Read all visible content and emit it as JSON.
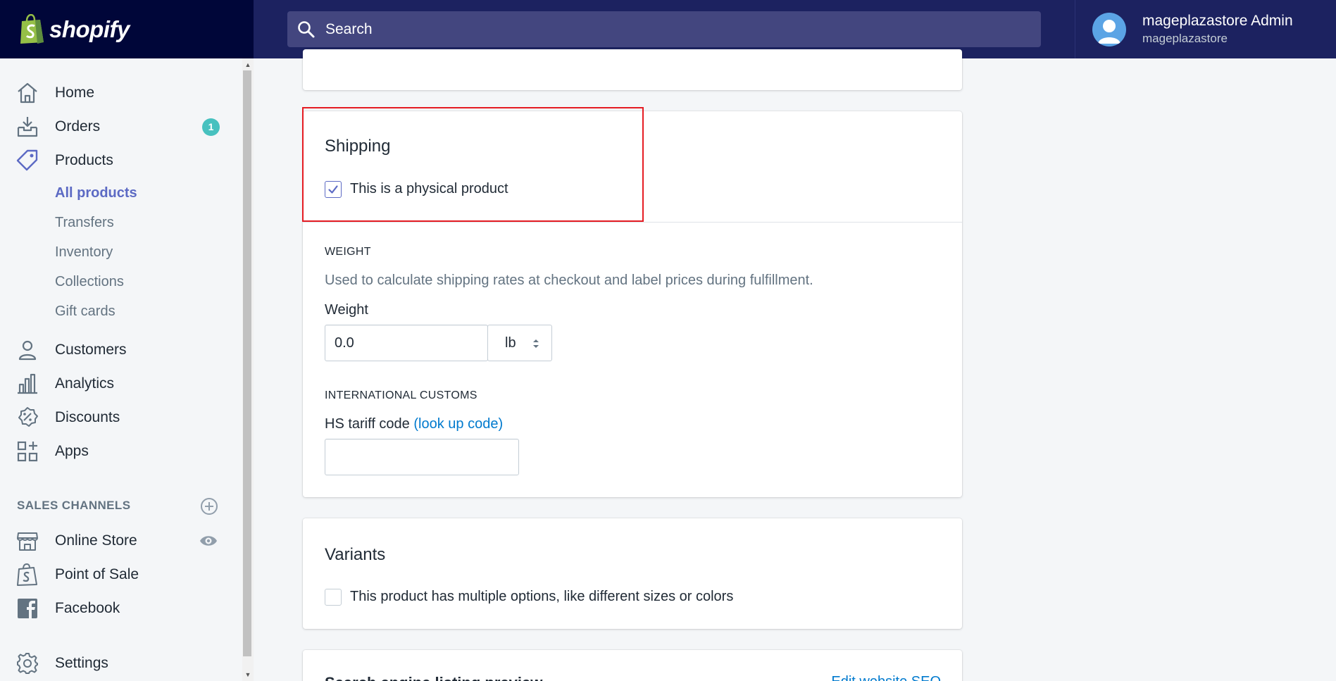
{
  "topbar": {
    "brand": "shopify",
    "search_placeholder": "Search",
    "account_name": "mageplazastore Admin",
    "account_store": "mageplazastore"
  },
  "sidebar": {
    "home": "Home",
    "orders": "Orders",
    "orders_badge": "1",
    "products": "Products",
    "products_sub": [
      "All products",
      "Transfers",
      "Inventory",
      "Collections",
      "Gift cards"
    ],
    "customers": "Customers",
    "analytics": "Analytics",
    "discounts": "Discounts",
    "apps": "Apps",
    "sales_channels_title": "SALES CHANNELS",
    "online_store": "Online Store",
    "point_of_sale": "Point of Sale",
    "facebook": "Facebook",
    "settings": "Settings"
  },
  "shipping": {
    "title": "Shipping",
    "physical_label": "This is a physical product",
    "physical_checked": true,
    "weight_heading": "WEIGHT",
    "weight_help": "Used to calculate shipping rates at checkout and label prices during fulfillment.",
    "weight_label": "Weight",
    "weight_value": "0.0",
    "weight_unit": "lb",
    "customs_heading": "INTERNATIONAL CUSTOMS",
    "hs_label": "HS tariff code",
    "hs_link": "(look up code)",
    "hs_value": ""
  },
  "variants": {
    "title": "Variants",
    "options_label": "This product has multiple options, like different sizes or colors",
    "options_checked": false
  },
  "seo": {
    "title_partial": "Search engine listing preview",
    "edit_link": "Edit website SEO"
  },
  "colors": {
    "topbar": "#1c2260",
    "brand_bg": "#000639",
    "accent": "#5c6ac4",
    "link": "#007ace",
    "badge": "#47c1bf",
    "highlight": "#e51c23"
  }
}
